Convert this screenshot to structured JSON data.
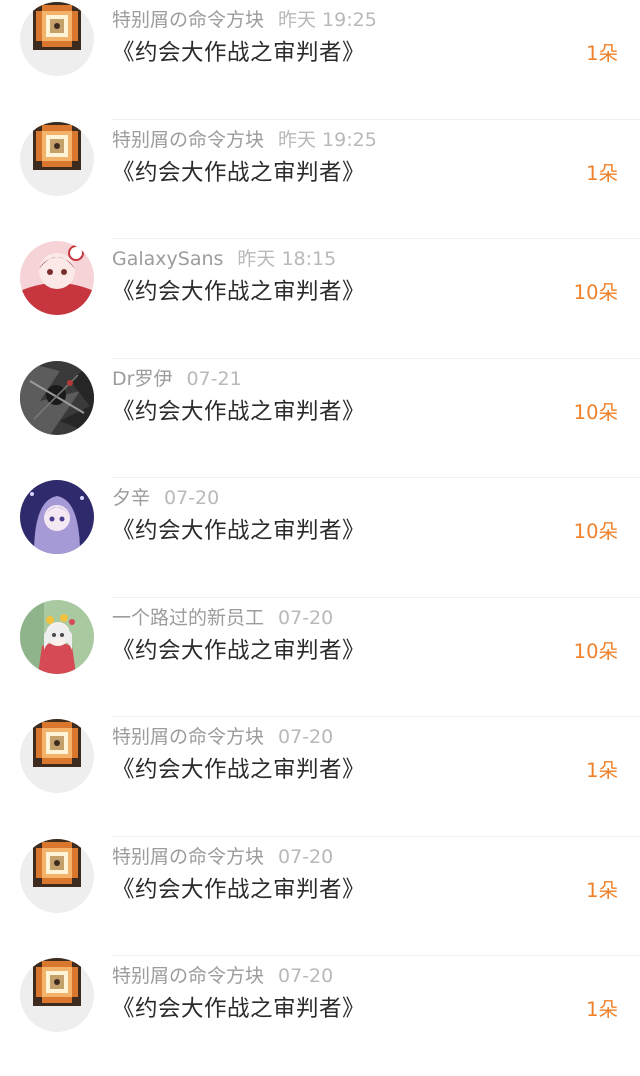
{
  "rows": [
    {
      "avatar": "command-block-avatar",
      "name": "特别屑の命令方块",
      "time": "昨天 19:25",
      "title": "《约会大作战之审判者》",
      "amount": "1朵"
    },
    {
      "avatar": "command-block-avatar",
      "name": "特别屑の命令方块",
      "time": "昨天 19:25",
      "title": "《约会大作战之审判者》",
      "amount": "1朵"
    },
    {
      "avatar": "anime-red-avatar",
      "name": "GalaxySans",
      "time": "昨天 18:15",
      "title": "《约会大作战之审判者》",
      "amount": "10朵"
    },
    {
      "avatar": "dark-gray-avatar",
      "name": "Dr罗伊",
      "time": "07-21",
      "title": "《约会大作战之审判者》",
      "amount": "10朵"
    },
    {
      "avatar": "anime-purple-avatar",
      "name": "夕辛",
      "time": "07-20",
      "title": "《约会大作战之审判者》",
      "amount": "10朵"
    },
    {
      "avatar": "anime-green-avatar",
      "name": "一个路过的新员工",
      "time": "07-20",
      "title": "《约会大作战之审判者》",
      "amount": "10朵"
    },
    {
      "avatar": "command-block-avatar",
      "name": "特别屑の命令方块",
      "time": "07-20",
      "title": "《约会大作战之审判者》",
      "amount": "1朵"
    },
    {
      "avatar": "command-block-avatar",
      "name": "特别屑の命令方块",
      "time": "07-20",
      "title": "《约会大作战之审判者》",
      "amount": "1朵"
    },
    {
      "avatar": "command-block-avatar",
      "name": "特别屑の命令方块",
      "time": "07-20",
      "title": "《约会大作战之审判者》",
      "amount": "1朵"
    }
  ],
  "colors": {
    "accent": "#f0812b",
    "name": "#9c9c9c",
    "time": "#b9b9b9",
    "title": "#2b2b2b",
    "divider": "#efefef"
  }
}
